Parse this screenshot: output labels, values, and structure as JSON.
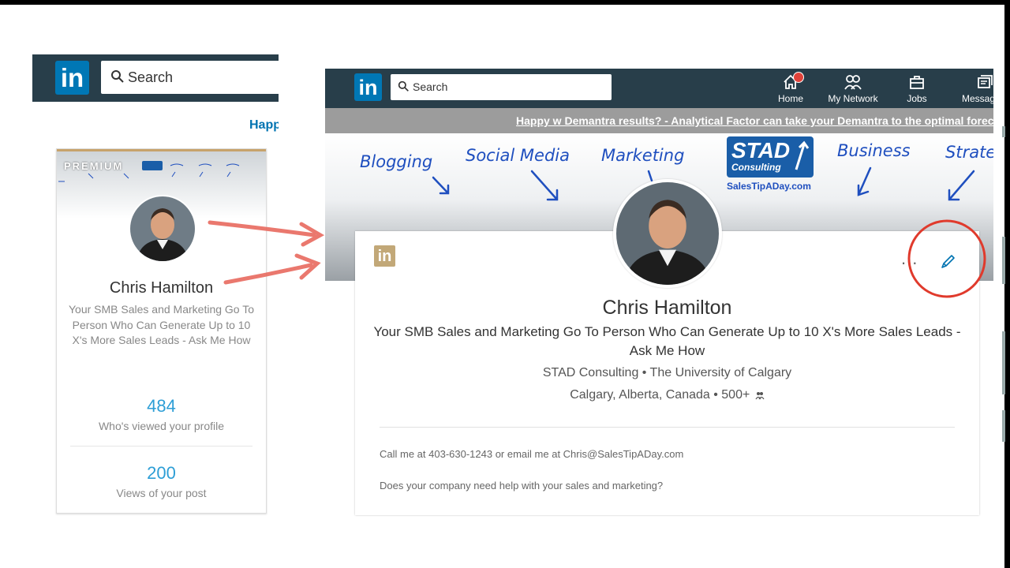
{
  "left_snippet": {
    "search_placeholder": "Search",
    "promo_fragment": "Happ",
    "logo_text": "in"
  },
  "profile_card_small": {
    "premium_label": "PREMIUM",
    "name": "Chris Hamilton",
    "headline": "Your SMB Sales and Marketing Go To Person Who Can Generate Up to 10 X's More Sales Leads - Ask Me How",
    "profile_views": "484",
    "profile_views_label": "Who's viewed your profile",
    "post_views": "200",
    "post_views_label": "Views of your post"
  },
  "nav": {
    "logo_text": "in",
    "search_placeholder": "Search",
    "items": [
      {
        "label": "Home",
        "icon": "home-icon"
      },
      {
        "label": "My Network",
        "icon": "network-icon"
      },
      {
        "label": "Jobs",
        "icon": "briefcase-icon"
      },
      {
        "label": "Messaging",
        "icon": "messaging-icon"
      }
    ]
  },
  "promo_banner": {
    "text": "Happy w Demantra results? - Analytical Factor can take your Demantra to the optimal forecast"
  },
  "banner": {
    "words": [
      "Blogging",
      "Social Media",
      "Marketing",
      "Business",
      "Strategy"
    ],
    "stad_logo_main": "STAD",
    "stad_logo_sub": "Consulting",
    "stad_url": "SalesTipADay.com"
  },
  "profile": {
    "badge_text": "in",
    "more_label": "...",
    "name": "Chris Hamilton",
    "headline": "Your SMB Sales and Marketing Go To Person Who Can Generate Up to 10 X's More Sales Leads - Ask Me How",
    "company_school": "STAD Consulting • The University of Calgary",
    "location_connections": "Calgary, Alberta, Canada • 500+",
    "summary_line1": "Call me at 403-630-1243 or email me at Chris@SalesTipADay.com",
    "summary_line2": "Does your company need help with your sales and marketing?"
  },
  "colors": {
    "nav_bg": "#283e4a",
    "linkedin_blue": "#0077b5",
    "stat_blue": "#2d9ed6",
    "premium_gold": "#c7a36b",
    "annotation_red": "#e03a2c"
  }
}
